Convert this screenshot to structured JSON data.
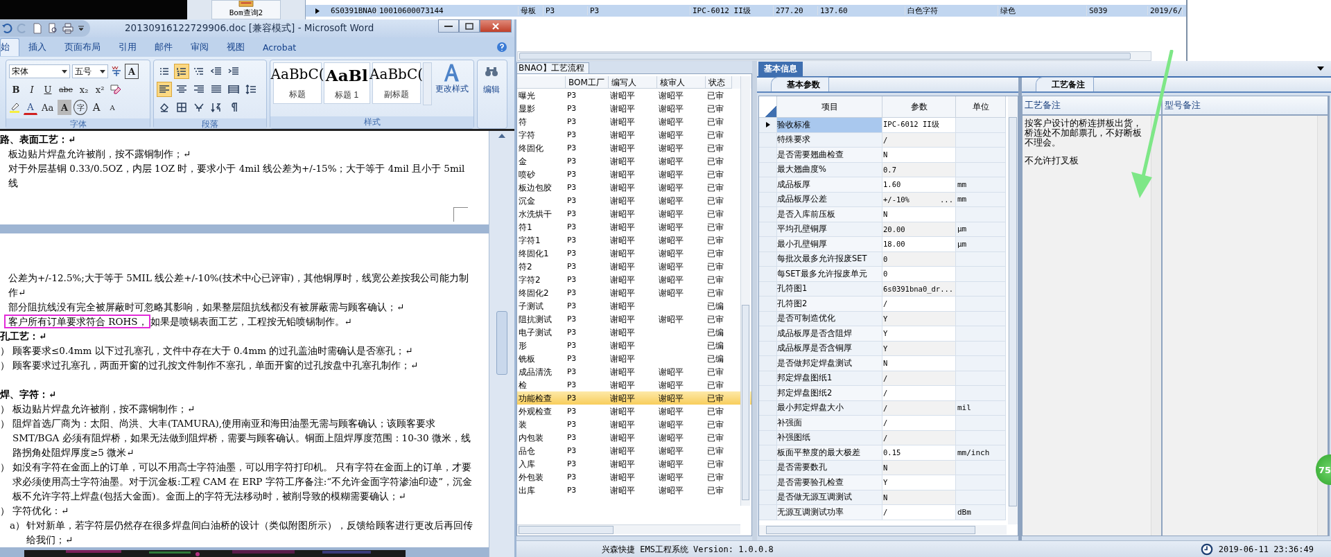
{
  "launcher": {
    "label": "Bom查询2"
  },
  "top_grid": {
    "rows": [
      {
        "selected": true,
        "cells": [
          "6S0391BNA0",
          "10010600073144",
          "母板",
          "P3",
          "P3",
          "IPC-6012 II级",
          "277.20",
          "137.60",
          "白色字符",
          "绿色",
          "S039",
          "2019/6/"
        ]
      }
    ]
  },
  "word_window": {
    "title": "20130916122729906.doc [兼容模式] - Microsoft Word",
    "tabs": [
      {
        "label": "始",
        "selected": true
      },
      {
        "label": "插入",
        "selected": false
      },
      {
        "label": "页面布局",
        "selected": false
      },
      {
        "label": "引用",
        "selected": false
      },
      {
        "label": "邮件",
        "selected": false
      },
      {
        "label": "审阅",
        "selected": false
      },
      {
        "label": "视图",
        "selected": false
      },
      {
        "label": "Acrobat",
        "selected": false
      }
    ],
    "font_group": {
      "label": "字体",
      "font": "宋体",
      "size": "五号",
      "rows": [
        [
          {
            "kind": "phonetic"
          },
          {
            "kind": "boxed",
            "label": "A"
          }
        ],
        [
          {
            "kind": "bold",
            "label": "B"
          },
          {
            "kind": "italic",
            "label": "I"
          },
          {
            "kind": "underline",
            "label": "U"
          },
          {
            "kind": "strike",
            "label": "abe"
          },
          {
            "kind": "plain",
            "label": "x₂"
          },
          {
            "kind": "plain",
            "label": "x²"
          },
          {
            "kind": "clear"
          }
        ],
        [
          {
            "kind": "highlight"
          },
          {
            "kind": "color",
            "label": "A"
          },
          {
            "kind": "plain",
            "label": "Aa"
          },
          {
            "kind": "shaded",
            "label": "A"
          },
          {
            "kind": "circled",
            "label": "字"
          },
          {
            "kind": "grow",
            "label": "A"
          },
          {
            "kind": "shrink",
            "label": "A"
          }
        ]
      ]
    },
    "paragraph_group": {
      "label": "段落",
      "rows": [
        [
          {
            "kind": "bullets",
            "on": false
          },
          {
            "kind": "numbering",
            "on": true
          },
          {
            "kind": "multilevel",
            "on": false
          },
          {
            "kind": "outdent",
            "on": false
          },
          {
            "kind": "indent",
            "on": false
          }
        ],
        [
          {
            "kind": "align-left",
            "on": true
          },
          {
            "kind": "align-center",
            "on": false
          },
          {
            "kind": "align-right",
            "on": false
          },
          {
            "kind": "justify",
            "on": false
          },
          {
            "kind": "distribute",
            "on": false
          },
          {
            "kind": "line-spacing",
            "on": false
          }
        ],
        [
          {
            "kind": "shading",
            "on": false
          },
          {
            "kind": "borders",
            "on": false
          },
          {
            "kind": "asian-layout",
            "on": false
          },
          {
            "kind": "sort",
            "on": false
          },
          {
            "kind": "marks",
            "on": false
          }
        ]
      ]
    },
    "styles_group": {
      "label": "样式",
      "styles": [
        {
          "kind": "title",
          "preview": "AaBbC(",
          "label": "标题"
        },
        {
          "kind": "heading1",
          "preview": "AaBl",
          "label": "标题 1"
        },
        {
          "kind": "subtitle",
          "preview": "AaBbC(",
          "label": "副标题"
        }
      ],
      "change_styles": "更改样式"
    },
    "editing": {
      "label": "编辑"
    },
    "pages": [
      {
        "paragraphs": [
          {
            "kind": "heading",
            "text": "路、表面工艺：↵"
          },
          {
            "kind": "text",
            "text": "板边贴片焊盘允许被削，按不露铜制作；↵"
          },
          {
            "kind": "text",
            "text": "对于外层基铜 0.33/0.5OZ，内层 1OZ 时，要求小于 4mil 线公差为+/-15%；大于等于 4mil 且小于 5mil 线"
          }
        ]
      },
      {
        "paragraphs": [
          {
            "kind": "text",
            "text": "公差为+/-12.5%;大于等于 5MIL 线公差+/-10%(技术中心已评审)，其他铜厚时，线宽公差按我公司能力制作↵"
          },
          {
            "kind": "text",
            "text": "部分阻抗线没有完全被屏蔽时可忽略其影响，如果整层阻抗线都没有被屏蔽需与顾客确认；↵"
          },
          {
            "kind": "framed",
            "framed_text": "客户所有订单要求符合 ROHS，",
            "text": "如果是喷锡表面工艺，工程按无铅喷锡制作。↵"
          },
          {
            "kind": "heading",
            "text": "孔工艺：↵"
          },
          {
            "kind": "item",
            "marker": "）",
            "text": "顾客要求≤0.4mm 以下过孔塞孔，文件中存在大于 0.4mm 的过孔盖油时需确认是否塞孔；↵"
          },
          {
            "kind": "item",
            "marker": "）",
            "text": "顾客要求过孔塞孔，两面开窗的过孔按文件制作不塞孔，单面开窗的过孔按盘中孔塞孔制作；↵"
          },
          {
            "kind": "spaced-heading",
            "text": "焊、字符：↵"
          },
          {
            "kind": "item",
            "marker": "）",
            "text": "板边贴片焊盘允许被削，按不露铜制作；↵"
          },
          {
            "kind": "item",
            "marker": "）",
            "text": "阻焊首选厂商为：太阳、尚洪、大丰(TAMURA),使用南亚和海田油墨无需与顾客确认；该顾客要求 SMT/BGA 必须有阻焊桥，如果无法做到阻焊桥，需要与顾客确认。铜面上阻焊厚度范围：10-30 微米，线路拐角处阻焊厚度≥5 微米↵"
          },
          {
            "kind": "item",
            "marker": "）",
            "text": "如没有字符在金面上的订单，可以不用高士字符油墨，可以用字符打印机。 只有字符在金面上的订单，才要求必须使用高士字符油墨。对于沉金板:工程 CAM 在 ERP 字符工序备注:“不允许金面字符渗油印迹”，沉金板不允许字符上焊盘(包括大金面)。金面上的字符无法移动时，被削导致的模糊需要确认；↵"
          },
          {
            "kind": "item",
            "marker": "）",
            "text": "字符优化：↵"
          },
          {
            "kind": "subitem",
            "marker": "a）",
            "text": "针对新单，若字符层仍然存在很多焊盘间白油桥的设计（类似附图所示），反馈给顾客进行更改后再回传给我们；↵"
          }
        ]
      }
    ]
  },
  "flow_panel": {
    "tab": "BNAO】工艺流程",
    "columns": [
      "BOM工厂",
      "编写人",
      "核审人",
      "状态"
    ],
    "rows": [
      {
        "step": "曝光",
        "factory": "P3",
        "writer": "谢昭平",
        "reviewer": "谢昭平",
        "status": "已审",
        "selected": false
      },
      {
        "step": "显影",
        "factory": "P3",
        "writer": "谢昭平",
        "reviewer": "谢昭平",
        "status": "已审",
        "selected": false
      },
      {
        "step": "符",
        "factory": "P3",
        "writer": "谢昭平",
        "reviewer": "谢昭平",
        "status": "已审",
        "selected": false
      },
      {
        "step": "字符",
        "factory": "P3",
        "writer": "谢昭平",
        "reviewer": "谢昭平",
        "status": "已审",
        "selected": false
      },
      {
        "step": "终固化",
        "factory": "P3",
        "writer": "谢昭平",
        "reviewer": "谢昭平",
        "status": "已审",
        "selected": false
      },
      {
        "step": "金",
        "factory": "P3",
        "writer": "谢昭平",
        "reviewer": "谢昭平",
        "status": "已审",
        "selected": false
      },
      {
        "step": "喷砂",
        "factory": "P3",
        "writer": "谢昭平",
        "reviewer": "谢昭平",
        "status": "已审",
        "selected": false
      },
      {
        "step": "板边包胶",
        "factory": "P3",
        "writer": "谢昭平",
        "reviewer": "谢昭平",
        "status": "已审",
        "selected": false
      },
      {
        "step": "沉金",
        "factory": "P3",
        "writer": "谢昭平",
        "reviewer": "谢昭平",
        "status": "已审",
        "selected": false
      },
      {
        "step": "水洗烘干",
        "factory": "P3",
        "writer": "谢昭平",
        "reviewer": "谢昭平",
        "status": "已审",
        "selected": false
      },
      {
        "step": "符1",
        "factory": "P3",
        "writer": "谢昭平",
        "reviewer": "谢昭平",
        "status": "已审",
        "selected": false
      },
      {
        "step": "字符1",
        "factory": "P3",
        "writer": "谢昭平",
        "reviewer": "谢昭平",
        "status": "已审",
        "selected": false
      },
      {
        "step": "终固化1",
        "factory": "P3",
        "writer": "谢昭平",
        "reviewer": "谢昭平",
        "status": "已审",
        "selected": false
      },
      {
        "step": "符2",
        "factory": "P3",
        "writer": "谢昭平",
        "reviewer": "谢昭平",
        "status": "已审",
        "selected": false
      },
      {
        "step": "字符2",
        "factory": "P3",
        "writer": "谢昭平",
        "reviewer": "谢昭平",
        "status": "已审",
        "selected": false
      },
      {
        "step": "终固化2",
        "factory": "P3",
        "writer": "谢昭平",
        "reviewer": "谢昭平",
        "status": "已审",
        "selected": false
      },
      {
        "step": "子测试",
        "factory": "P3",
        "writer": "谢昭平",
        "status": "已编",
        "selected": false
      },
      {
        "step": "阻抗测试",
        "factory": "P3",
        "writer": "谢昭平",
        "reviewer": "谢昭平",
        "status": "已审",
        "selected": false
      },
      {
        "step": "电子测试",
        "factory": "P3",
        "writer": "谢昭平",
        "status": "已编",
        "selected": false
      },
      {
        "step": "形",
        "factory": "P3",
        "writer": "谢昭平",
        "status": "已编",
        "selected": false
      },
      {
        "step": "铣板",
        "factory": "P3",
        "writer": "谢昭平",
        "status": "已编",
        "selected": false
      },
      {
        "step": "成品清洗",
        "factory": "P3",
        "writer": "谢昭平",
        "reviewer": "谢昭平",
        "status": "已审",
        "selected": false
      },
      {
        "step": "检",
        "factory": "P3",
        "writer": "谢昭平",
        "reviewer": "谢昭平",
        "status": "已审",
        "selected": false
      },
      {
        "step": "功能检查",
        "factory": "P3",
        "writer": "谢昭平",
        "reviewer": "谢昭平",
        "status": "已审",
        "selected": true
      },
      {
        "step": "外观检查",
        "factory": "P3",
        "writer": "谢昭平",
        "reviewer": "谢昭平",
        "status": "已审",
        "selected": false
      },
      {
        "step": "装",
        "factory": "P3",
        "writer": "谢昭平",
        "reviewer": "谢昭平",
        "status": "已审",
        "selected": false
      },
      {
        "step": "内包装",
        "factory": "P3",
        "writer": "谢昭平",
        "reviewer": "谢昭平",
        "status": "已审",
        "selected": false
      },
      {
        "step": "品仓",
        "factory": "P3",
        "writer": "谢昭平",
        "reviewer": "谢昭平",
        "status": "已审",
        "selected": false
      },
      {
        "step": "入库",
        "factory": "P3",
        "writer": "谢昭平",
        "reviewer": "谢昭平",
        "status": "已审",
        "selected": false
      },
      {
        "step": "外包装",
        "factory": "P3",
        "writer": "谢昭平",
        "reviewer": "谢昭平",
        "status": "已审",
        "selected": false
      },
      {
        "step": "出库",
        "factory": "P3",
        "writer": "谢昭平",
        "reviewer": "谢昭平",
        "status": "已审",
        "selected": false
      }
    ]
  },
  "info_panel": {
    "tab": "基本信息",
    "params": {
      "tab": "基本参数",
      "columns": [
        "项目",
        "参数",
        "单位"
      ],
      "rows": [
        {
          "item": "验收标准",
          "value": "IPC-6012 II级",
          "selected": true
        },
        {
          "item": "特殊要求",
          "value": "/",
          "selected": false
        },
        {
          "item": "是否需要翘曲检查",
          "value": "N",
          "selected": false
        },
        {
          "item": "最大翘曲度%",
          "value": "0.7",
          "selected": false
        },
        {
          "item": "成品板厚",
          "value": "1.60",
          "unit": "mm",
          "selected": false
        },
        {
          "item": "成品板厚公差",
          "value": "+/-10%",
          "unit": "mm",
          "ellipsis": "...",
          "selected": false
        },
        {
          "item": "是否入库前压板",
          "value": "N",
          "selected": false
        },
        {
          "item": "平均孔壁铜厚",
          "value": "20.00",
          "unit": "μm",
          "selected": false
        },
        {
          "item": "最小孔壁铜厚",
          "value": "18.00",
          "unit": "μm",
          "selected": false
        },
        {
          "item": "每批次最多允许报废SET",
          "value": "0",
          "selected": false
        },
        {
          "item": "每SET最多允许报废单元",
          "value": "0",
          "selected": false
        },
        {
          "item": "孔符图1",
          "value": "6s0391bna0_dr...",
          "selected": false
        },
        {
          "item": "孔符图2",
          "value": "/",
          "selected": false
        },
        {
          "item": "是否可制造优化",
          "value": "Y",
          "selected": false
        },
        {
          "item": "成品板厚是否含阻焊",
          "value": "Y",
          "selected": false
        },
        {
          "item": "成品板厚是否含铜厚",
          "value": "Y",
          "selected": false
        },
        {
          "item": "是否做邦定焊盘测试",
          "value": "N",
          "selected": false
        },
        {
          "item": "邦定焊盘图纸1",
          "value": "/",
          "selected": false
        },
        {
          "item": "邦定焊盘图纸2",
          "value": "/",
          "selected": false
        },
        {
          "item": "最小邦定焊盘大小",
          "value": "/",
          "unit": "mil",
          "selected": false
        },
        {
          "item": "补强面",
          "value": "/",
          "selected": false
        },
        {
          "item": "补强图纸",
          "value": "/",
          "selected": false
        },
        {
          "item": "板面平整度的最大极差",
          "value": "0.15",
          "unit": "mm/inch",
          "selected": false
        },
        {
          "item": "是否需要数孔",
          "value": "N",
          "selected": false
        },
        {
          "item": "是否需要验孔检查",
          "value": "Y",
          "selected": false
        },
        {
          "item": "是否做无源互调测试",
          "value": "N",
          "selected": false
        },
        {
          "item": "无源互调测试功率",
          "value": "/",
          "unit": "dBm",
          "selected": false
        }
      ]
    },
    "notes": {
      "tab": "工艺备注",
      "columns": [
        {
          "title": "工艺备注",
          "lines": [
            "按客户设计的桥连拼板出货，桥连处不加邮票孔，不好断板不理会。",
            "不允许打叉板"
          ]
        },
        {
          "title": "型号备注"
        }
      ]
    }
  },
  "status_bar": {
    "version": "兴森快捷 EMS工程系统 Version: 1.0.0.8",
    "datetime": "2019-06-11 23:36:49"
  },
  "badge": {
    "label": "75"
  }
}
